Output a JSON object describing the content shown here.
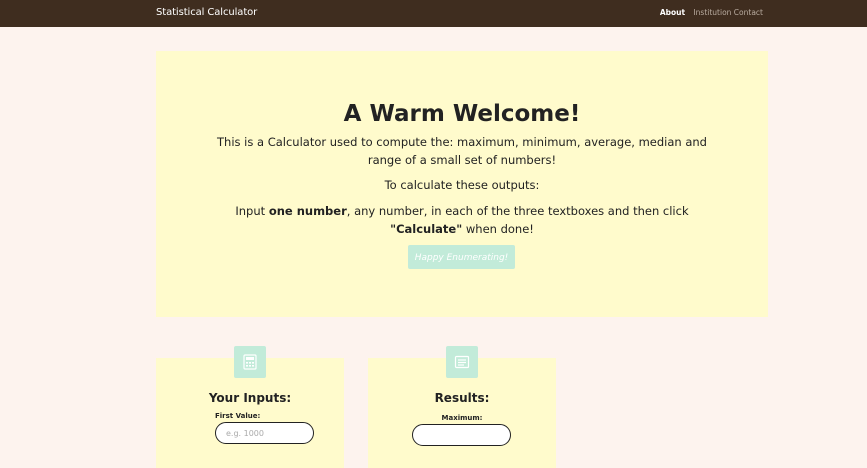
{
  "navbar": {
    "brand": "Statistical Calculator",
    "links": {
      "about": "About",
      "contact": "Institution Contact"
    }
  },
  "hero": {
    "title": "A Warm Welcome!",
    "description": "This is a Calculator used to compute the: maximum, minimum, average, median and range of a small set of numbers!",
    "subtitle": "To calculate these outputs:",
    "instruction": {
      "prefix": "Input ",
      "bold1": "one number",
      "middle": ", any number, in each of the three textboxes and then click ",
      "bold2": "\"Calculate\"",
      "suffix": " when done!"
    },
    "button_label": "Happy Enumerating!"
  },
  "inputs_card": {
    "title": "Your Inputs:",
    "icon": "calculator-icon",
    "first_label": "First Value:",
    "first_placeholder": "e.g. 1000",
    "first_value": ""
  },
  "results_card": {
    "title": "Results:",
    "icon": "list-icon",
    "max_label": "Maximum:",
    "max_value": ""
  },
  "colors": {
    "navbar": "#3f2d1f",
    "page_bg": "#fdf3ee",
    "panel_bg": "#fffbcc",
    "accent": "#c2ebd9"
  }
}
